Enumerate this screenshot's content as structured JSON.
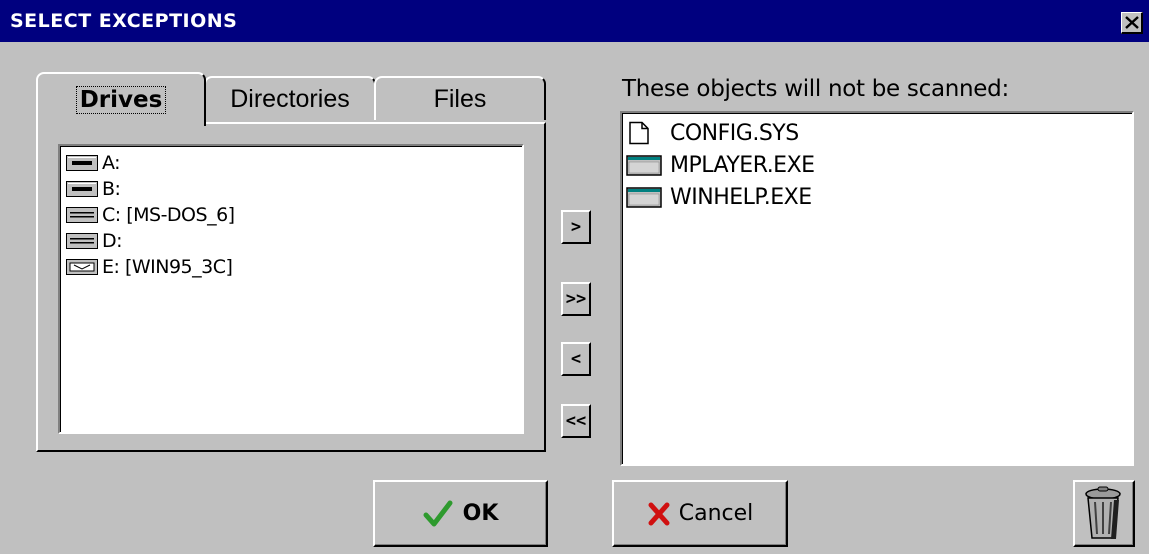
{
  "window": {
    "title": "SELECT EXCEPTIONS",
    "close_icon": "close-icon"
  },
  "tabs": [
    {
      "label": "Drives",
      "selected": true
    },
    {
      "label": "Directories",
      "selected": false
    },
    {
      "label": "Files",
      "selected": false
    }
  ],
  "drives": [
    {
      "label": "A:",
      "icon": "floppy-drive-icon"
    },
    {
      "label": "B:",
      "icon": "floppy-drive-icon"
    },
    {
      "label": "C: [MS-DOS_6]",
      "icon": "hard-drive-icon"
    },
    {
      "label": "D:",
      "icon": "hard-drive-icon"
    },
    {
      "label": "E: [WIN95_3C]",
      "icon": "cdrom-drive-icon"
    }
  ],
  "move_buttons": {
    "add": ">",
    "add_all": ">>",
    "remove": "<",
    "remove_all": "<<"
  },
  "exclusions": {
    "caption": "These objects will not be scanned:",
    "items": [
      {
        "label": "CONFIG.SYS",
        "icon": "document-icon"
      },
      {
        "label": "MPLAYER.EXE",
        "icon": "application-icon"
      },
      {
        "label": "WINHELP.EXE",
        "icon": "application-icon"
      }
    ]
  },
  "buttons": {
    "ok": "OK",
    "cancel": "Cancel",
    "trash_icon": "trash-can-icon"
  },
  "colors": {
    "titlebar": "#00007f",
    "face": "#c0c0c0",
    "ok_check": "#2e9a2e",
    "cancel_x": "#d01010"
  }
}
